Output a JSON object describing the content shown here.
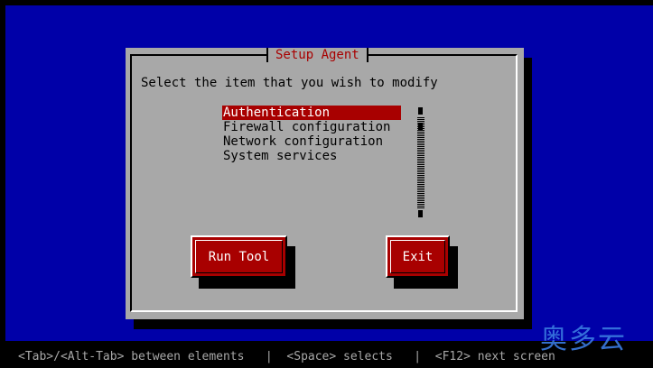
{
  "dialog": {
    "title": "Setup Agent",
    "prompt": "Select the item that you wish to modify",
    "items": [
      {
        "label": "Authentication",
        "selected": true
      },
      {
        "label": "Firewall configuration",
        "selected": false
      },
      {
        "label": "Network configuration",
        "selected": false
      },
      {
        "label": "System services",
        "selected": false
      }
    ],
    "buttons": {
      "run_tool": "Run Tool",
      "exit": "Exit"
    }
  },
  "statusbar": {
    "text": "<Tab>/<Alt-Tab> between elements   |  <Space> selects   |  <F12> next screen"
  },
  "watermark": {
    "text": "奥多云"
  },
  "colors": {
    "backdrop": "#0000a8",
    "dialog": "#a8a8a8",
    "accent": "#a80000",
    "statusbar": "#000000"
  },
  "icons": {
    "scrollbar": "scrollbar-track-icon"
  }
}
